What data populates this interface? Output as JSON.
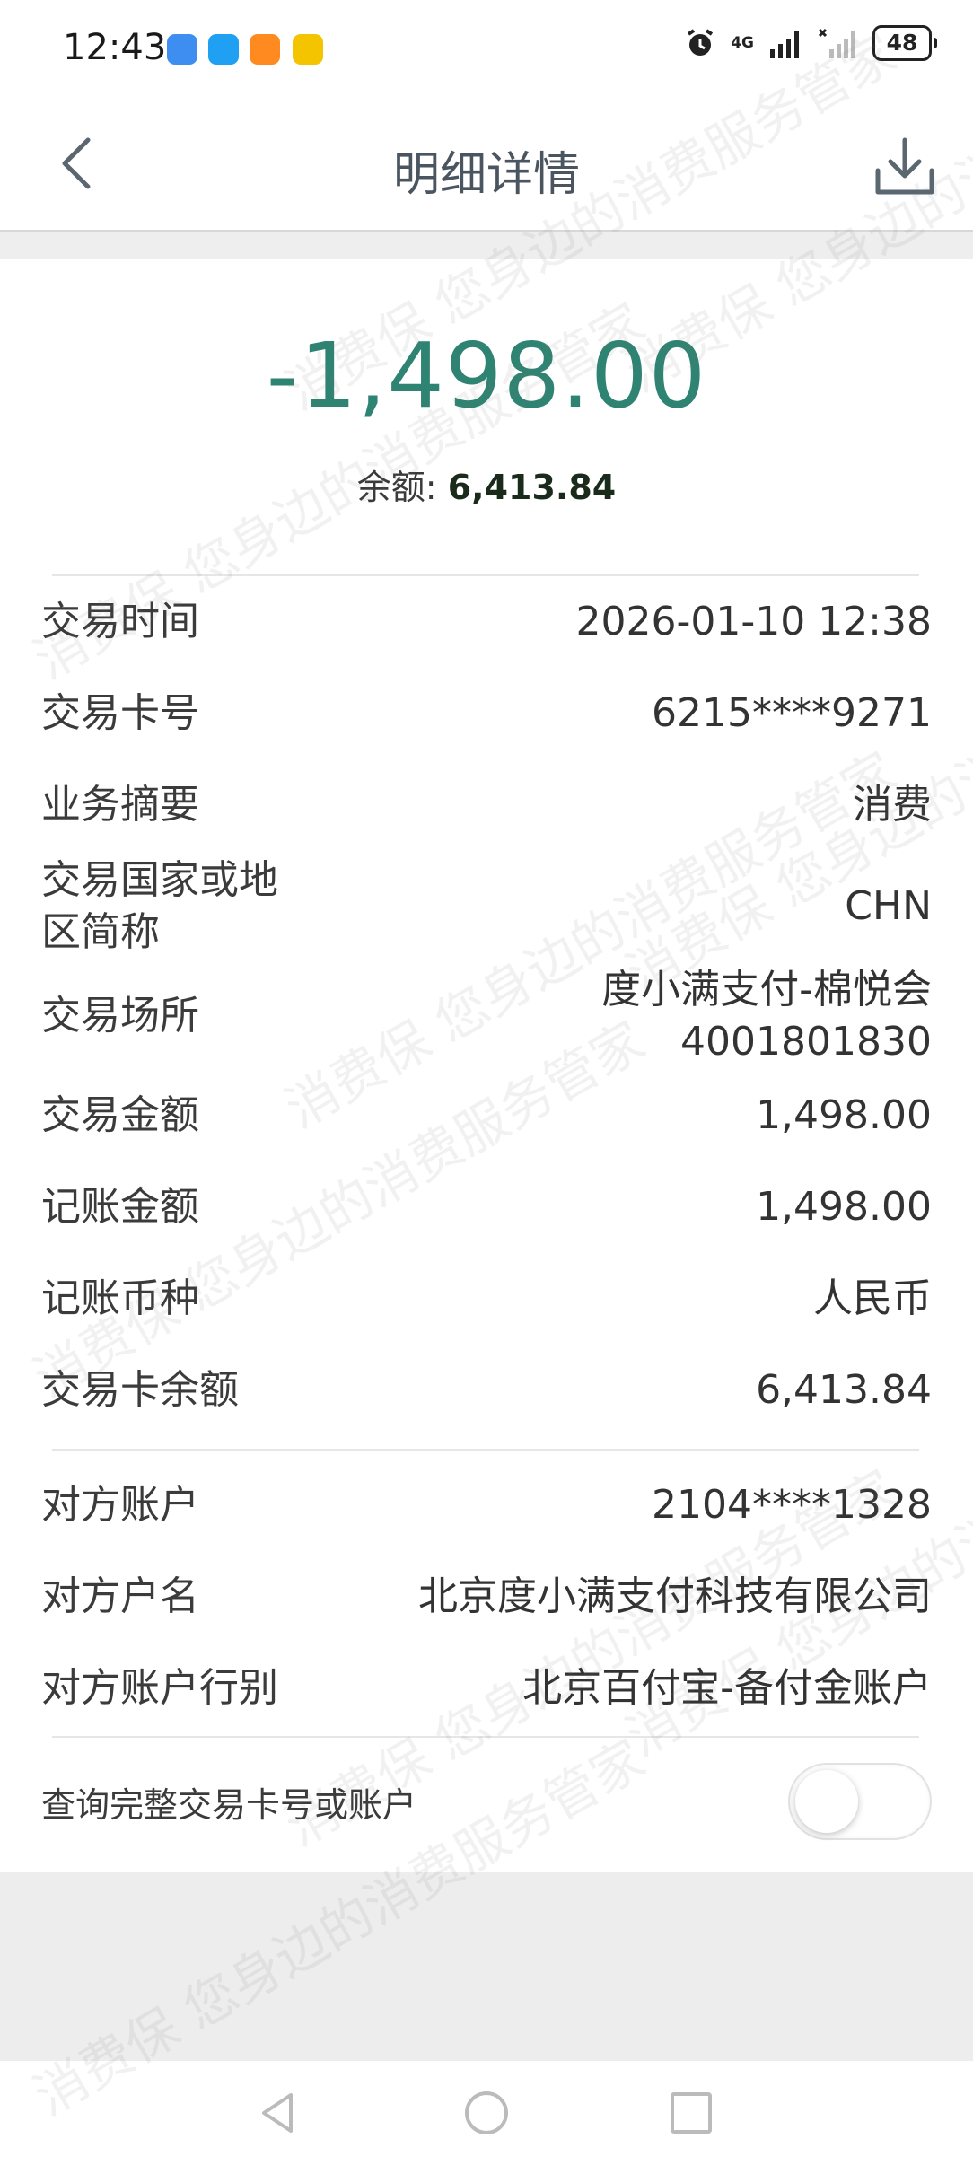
{
  "status_bar": {
    "time": "12:43",
    "network": "4G",
    "battery": "48",
    "icons": [
      "alarm-icon",
      "signal-icon",
      "no-signal-icon",
      "battery-icon"
    ]
  },
  "header": {
    "title": "明细详情",
    "back_icon": "chevron-left-icon",
    "download_icon": "download-icon"
  },
  "summary": {
    "amount": "-1,498.00",
    "balance_label": "余额:",
    "balance_value": "6,413.84",
    "amount_color": "#2f8372"
  },
  "details": [
    {
      "label": "交易时间",
      "value": "2026-01-10 12:38"
    },
    {
      "label": "交易卡号",
      "value": "6215****9271"
    },
    {
      "label": "业务摘要",
      "value": "消费"
    },
    {
      "label": "交易国家或地区简称",
      "value": "CHN"
    },
    {
      "label": "交易场所",
      "value": "度小满支付-棉悦会 4001801830"
    },
    {
      "label": "交易金额",
      "value": "1,498.00"
    },
    {
      "label": "记账金额",
      "value": "1,498.00"
    },
    {
      "label": "记账币种",
      "value": "人民币"
    },
    {
      "label": "交易卡余额",
      "value": "6,413.84"
    }
  ],
  "counterparty": [
    {
      "label": "对方账户",
      "value": "2104****1328"
    },
    {
      "label": "对方户名",
      "value": "北京度小满支付科技有限公司"
    },
    {
      "label": "对方账户行别",
      "value": "北京百付宝-备付金账户"
    }
  ],
  "toggle": {
    "label": "查询完整交易卡号或账户",
    "on": false
  },
  "watermark": "消费保 您身边的消费服务管家",
  "system_nav": [
    "back-icon",
    "home-icon",
    "recents-icon"
  ]
}
